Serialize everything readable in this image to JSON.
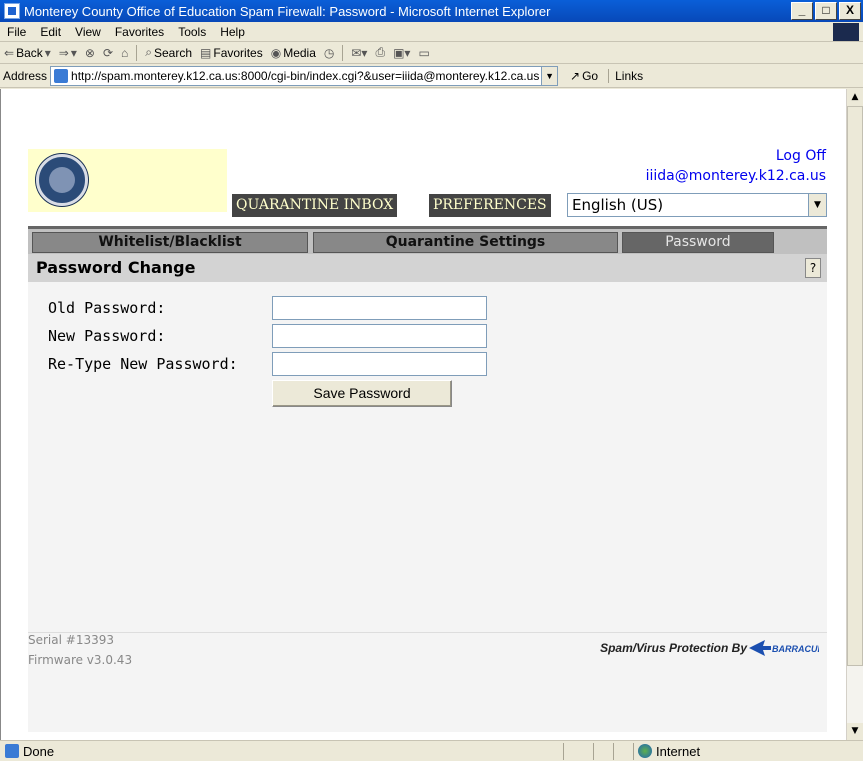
{
  "window": {
    "title": "Monterey County Office of Education Spam Firewall: Password - Microsoft Internet Explorer",
    "controls": [
      "_",
      "□",
      "X"
    ]
  },
  "menu": [
    "File",
    "Edit",
    "View",
    "Favorites",
    "Tools",
    "Help"
  ],
  "toolbar": {
    "back": "Back",
    "search": "Search",
    "favorites": "Favorites",
    "media": "Media"
  },
  "address": {
    "label": "Address",
    "url": "http://spam.monterey.k12.ca.us:8000/cgi-bin/index.cgi?&user=iiida@monterey.k12.ca.us",
    "go": "Go",
    "links": "Links"
  },
  "page": {
    "logoff": "Log Off",
    "user_email": "iiida@monterey.k12.ca.us",
    "tabs": {
      "quarantine_inbox": "QUARANTINE INBOX",
      "preferences": "PREFERENCES"
    },
    "language": "English (US)",
    "subtabs": [
      "Whitelist/Blacklist",
      "Quarantine Settings",
      "Password"
    ],
    "section_title": "Password Change",
    "help": "?",
    "form": {
      "old_password_label": "Old Password:",
      "new_password_label": "New Password:",
      "retype_label": "Re-Type New Password:",
      "save_button": "Save Password"
    },
    "footer": {
      "serial": "Serial #13393",
      "firmware": "Firmware v3.0.43",
      "protection": "Spam/Virus Protection By",
      "brand": "BARRACUDA"
    }
  },
  "status": {
    "text": "Done",
    "zone": "Internet"
  }
}
